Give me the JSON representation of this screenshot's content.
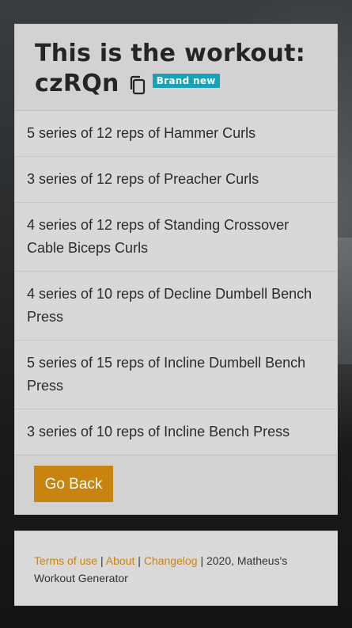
{
  "workout": {
    "title_prefix": "This is the workout:",
    "code": "czRQn",
    "badge": "Brand new",
    "copy_icon": "copy-icon"
  },
  "exercises": [
    "5 series of 12 reps of Hammer Curls",
    "3 series of 12 reps of Preacher Curls",
    "4 series of 12 reps of Standing Crossover Cable Biceps Curls",
    "4 series of 10 reps of Decline Dumbell Bench Press",
    "5 series of 15 reps of Incline Dumbell Bench Press",
    "3 series of 10 reps of Incline Bench Press"
  ],
  "actions": {
    "go_back": "Go Back"
  },
  "footer": {
    "terms": "Terms of use",
    "sep1": "|",
    "about": "About",
    "sep2": "|",
    "changelog": "Changelog",
    "credit": "| 2020, Matheus's Workout Generator"
  },
  "colors": {
    "accent": "#c9840f",
    "badge": "#17a2b8",
    "card": "#d8d8d8"
  }
}
